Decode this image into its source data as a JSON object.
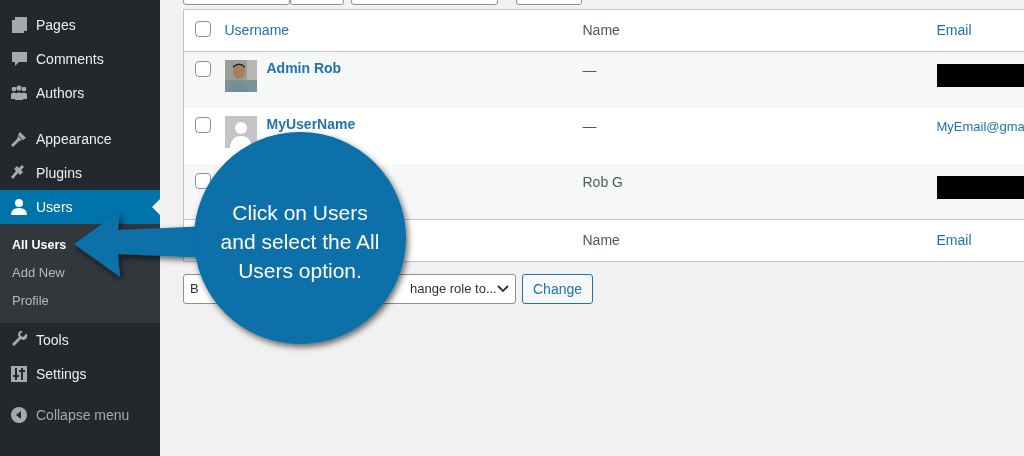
{
  "sidebar": {
    "groups": [
      [
        {
          "label": "Pages",
          "selected": false
        },
        {
          "label": "Comments",
          "selected": false
        },
        {
          "label": "Authors",
          "selected": false
        }
      ],
      [
        {
          "label": "Appearance",
          "selected": false
        },
        {
          "label": "Plugins",
          "selected": false
        },
        {
          "label": "Users",
          "selected": true,
          "children": [
            {
              "label": "All Users",
              "selected": true
            },
            {
              "label": "Add New",
              "selected": false
            },
            {
              "label": "Profile",
              "selected": false
            }
          ]
        },
        {
          "label": "Tools",
          "selected": false
        },
        {
          "label": "Settings",
          "selected": false
        }
      ]
    ],
    "collapse": "Collapse menu"
  },
  "table": {
    "header_checked": false,
    "columns": [
      {
        "label": "Username",
        "kind": "link"
      },
      {
        "label": "Name",
        "kind": "plain"
      },
      {
        "label": "Email",
        "kind": "link"
      }
    ],
    "rows": [
      {
        "checked": false,
        "username": "Admin Rob",
        "name": "—",
        "email_redacted": true
      },
      {
        "checked": false,
        "avatar": {
          "kind": "default"
        },
        "username": "MyUserName",
        "name": "—",
        "email": "MyEmail@gma"
      },
      {
        "checked": false,
        "name": "Rob G",
        "email_redacted": true
      }
    ],
    "footer_columns": [
      {
        "label": "Name",
        "kind": "plain"
      },
      {
        "label": "Email",
        "kind": "link"
      }
    ]
  },
  "bulk_actions": {
    "bulk_select": "B",
    "role_select": "hange role to...",
    "change_button": "Change"
  },
  "callout": {
    "text": "Click on Users\nand select the All\nUsers option."
  }
}
